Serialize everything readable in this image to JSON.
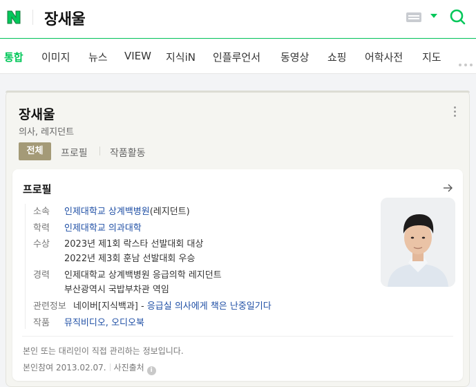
{
  "header": {
    "query": "장새울",
    "logo_letter": "N"
  },
  "tabs": [
    "통합",
    "이미지",
    "뉴스",
    "VIEW",
    "지식iN",
    "인플루언서",
    "동영상",
    "쇼핑",
    "어학사전",
    "지도"
  ],
  "profile": {
    "name": "장새울",
    "role": "의사, 레지던트",
    "subtabs": [
      "전체",
      "프로필",
      "작품활동"
    ],
    "section_title": "프로필",
    "rows": {
      "affiliation": {
        "label": "소속",
        "link": "인제대학교 상계백병원",
        "suffix": "(레지던트)"
      },
      "education": {
        "label": "학력",
        "link": "인제대학교 의과대학"
      },
      "awards": {
        "label": "수상",
        "lines": [
          "2023년 제1회 락스타 선발대회 대상",
          "2022년 제3회 훈남 선발대회 우승"
        ]
      },
      "career": {
        "label": "경력",
        "lines": [
          "인제대학교 상계백병원 응급의학 레지던트",
          "부산광역시 국밥부차관 역임"
        ]
      },
      "related": {
        "label": "관련정보",
        "prefix": "네이버[지식백과] - ",
        "link": "응급실 의사에게 책은 난중일기다"
      },
      "works": {
        "label": "작품",
        "link": "뮤직비디오, 오디오북"
      }
    },
    "footer": {
      "notice": "본인 또는 대리인이 직접 관리하는 정보입니다.",
      "participation": "본인참여",
      "date": "2013.02.07.",
      "photo_source": "사진출처",
      "info_symbol": "i"
    }
  },
  "colors": {
    "brand": "#03c75a",
    "subtab_active": "#a49a77",
    "link": "#1f4fa5"
  }
}
